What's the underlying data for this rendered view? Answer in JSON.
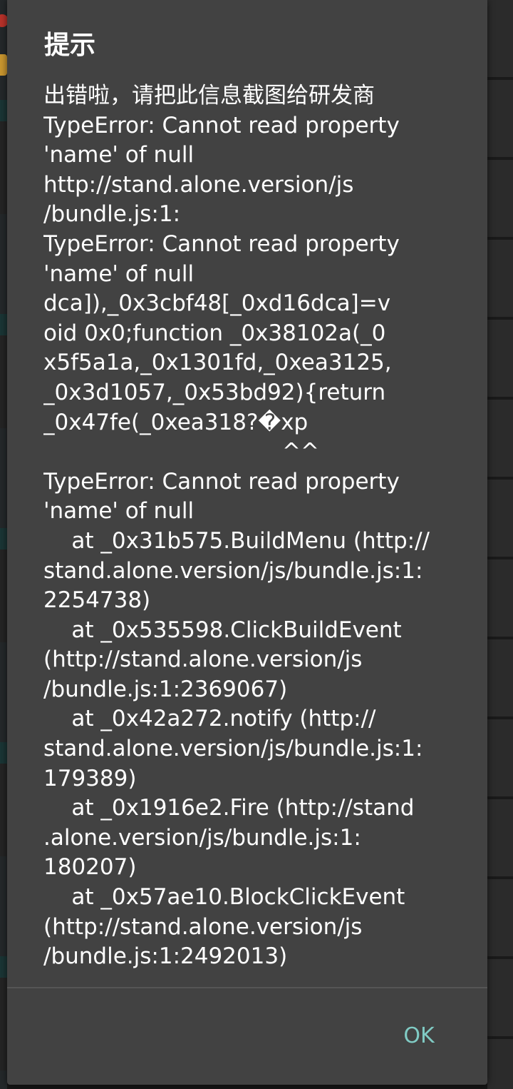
{
  "dialog": {
    "title": "提示",
    "message_lines": [
      "出错啦，请把此信息截图给研发商",
      "TypeError: Cannot read property",
      "'name' of null",
      "http://stand.alone.version/js",
      "/bundle.js:1:",
      "TypeError: Cannot read property",
      "'name' of null",
      "dca]),_0x3cbf48[_0xd16dca]=v",
      "oid 0x0;function _0x38102a(_0",
      "x5f5a1a,_0x1301fd,_0xea3125,",
      "_0x3d1057,_0x53bd92){return",
      "_0x47fe(_0xea318?�xp",
      "                                  ^^",
      "TypeError: Cannot read property",
      "'name' of null",
      "    at _0x31b575.BuildMenu (http://",
      "stand.alone.version/js/bundle.js:1:",
      "2254738)",
      "    at _0x535598.ClickBuildEvent",
      "(http://stand.alone.version/js",
      "/bundle.js:1:2369067)",
      "    at _0x42a272.notify (http://",
      "stand.alone.version/js/bundle.js:1:",
      "179389)",
      "    at _0x1916e2.Fire (http://stand",
      ".alone.version/js/bundle.js:1:",
      "180207)",
      "    at _0x57ae10.BlockClickEvent",
      "(http://stand.alone.version/js",
      "/bundle.js:1:2492013)"
    ],
    "ok_label": "OK"
  },
  "colors": {
    "dialog_background": "#424242",
    "text": "#ffffff",
    "accent": "#80cbc4"
  }
}
